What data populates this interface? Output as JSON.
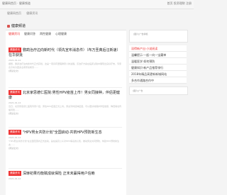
{
  "topbar": {
    "crumb": "健康网首页 · 健康频道",
    "links": "首页  投资理财  注册"
  },
  "subnav": [
    "健康网首页",
    "健康资讯"
  ],
  "section_title": "健康频道",
  "tabs": [
    "健康资讯",
    "健康问答",
    "两性健康",
    "心理健康"
  ],
  "articles": [
    {
      "tag": "健康资讯",
      "title": "鹦鹉治疗边向新时代（领先宣布消息件）（布万圣典后汪新速）在华获批",
      "date": "2021-01-12",
      "body": "据悉，鹦鹉治疗边向新时代正式获批，这是一项具有里程碑意义的进展。该治疗方案在临床试验中展现出良好疗效，专家表示将为更多患者带来希望……",
      "more": "[阅读全文]"
    },
    {
      "tag": "健康资讯",
      "title": "北京家思德仁医院:男性HPV疫苗上市！男女同接种，伴侣更健康",
      "date": "2021-01-12",
      "body": "近日，北京家思德仁医院专家介绍，男性HPV疫苗正式上市。男女同时接种疫苗，可以更好地保护伴侣健康，降低病毒传播风险……",
      "more": "[阅读全文]"
    },
    {
      "tag": "健康资讯",
      "title": "\"HPV男女共防计划\"全国启动·共筑HPV预防新生态",
      "date": "2021-01-12",
      "body": "\"HPV男女共防计划\"在全国范围内正式启动，旨在提高公众对HPV病毒的认知，推动男女共同预防，构建HPV预防新生态……",
      "more": "[阅读全文]"
    },
    {
      "tag": "健康资讯",
      "title": "深琢初果均衡赋成就保险 正末未赢得用户信赖",
      "date": "2021-01-12",
      "body": "",
      "more": ""
    }
  ],
  "side": {
    "ad_text": "[图片]广告横幅",
    "items": [
      "深得新产出·小说阅读",
      "温馨提示·一起一向一宝藏单",
      "温暖医学·如何预防",
      "健康知识·新产品推荐排行",
      "2018年精品高更新新城网站",
      "多合作通路合作中"
    ],
    "ad2_text": "[图片]广告"
  }
}
